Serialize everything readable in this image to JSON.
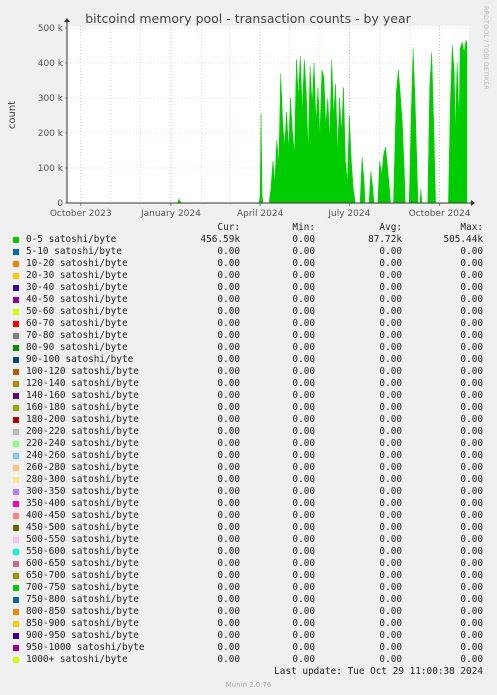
{
  "chart_data": {
    "type": "area",
    "title": "bitcoind memory pool - transaction counts - by year",
    "ylabel": "count",
    "watermark": "RRDTOOL / TOBI OETIKER",
    "ylim": [
      0,
      500000
    ],
    "y_ticks": [
      {
        "value": 0,
        "label": "0"
      },
      {
        "value": 100000,
        "label": "100 k"
      },
      {
        "value": 200000,
        "label": "200 k"
      },
      {
        "value": 300000,
        "label": "300 k"
      },
      {
        "value": 400000,
        "label": "400 k"
      },
      {
        "value": 500000,
        "label": "500 k"
      }
    ],
    "x_ticks": [
      "October 2023",
      "January 2024",
      "April 2024",
      "July 2024",
      "October 2024"
    ],
    "series": [
      {
        "name": "0-5 satoshi/byte",
        "color": "#00cc00",
        "points": [
          [
            "2024-01-08",
            0
          ],
          [
            "2024-01-09",
            12000
          ],
          [
            "2024-01-10",
            6000
          ],
          [
            "2024-01-12",
            0
          ],
          [
            "2024-03-31",
            0
          ],
          [
            "2024-04-01",
            20000
          ],
          [
            "2024-04-02",
            255000
          ],
          [
            "2024-04-03",
            20000
          ],
          [
            "2024-04-04",
            0
          ],
          [
            "2024-04-10",
            0
          ],
          [
            "2024-04-12",
            40000
          ],
          [
            "2024-04-14",
            120000
          ],
          [
            "2024-04-16",
            60000
          ],
          [
            "2024-04-18",
            180000
          ],
          [
            "2024-04-20",
            110000
          ],
          [
            "2024-04-22",
            370000
          ],
          [
            "2024-04-24",
            230000
          ],
          [
            "2024-04-26",
            160000
          ],
          [
            "2024-04-28",
            260000
          ],
          [
            "2024-04-30",
            150000
          ],
          [
            "2024-05-02",
            300000
          ],
          [
            "2024-05-04",
            200000
          ],
          [
            "2024-05-06",
            140000
          ],
          [
            "2024-05-08",
            410000
          ],
          [
            "2024-05-10",
            300000
          ],
          [
            "2024-05-12",
            420000
          ],
          [
            "2024-05-14",
            260000
          ],
          [
            "2024-05-16",
            410000
          ],
          [
            "2024-05-18",
            320000
          ],
          [
            "2024-05-20",
            150000
          ],
          [
            "2024-05-22",
            390000
          ],
          [
            "2024-05-24",
            280000
          ],
          [
            "2024-05-26",
            400000
          ],
          [
            "2024-05-28",
            230000
          ],
          [
            "2024-05-30",
            330000
          ],
          [
            "2024-06-01",
            190000
          ],
          [
            "2024-06-03",
            380000
          ],
          [
            "2024-06-05",
            360000
          ],
          [
            "2024-06-07",
            220000
          ],
          [
            "2024-06-09",
            300000
          ],
          [
            "2024-06-11",
            180000
          ],
          [
            "2024-06-13",
            410000
          ],
          [
            "2024-06-15",
            250000
          ],
          [
            "2024-06-17",
            340000
          ],
          [
            "2024-06-19",
            140000
          ],
          [
            "2024-06-21",
            300000
          ],
          [
            "2024-06-23",
            200000
          ],
          [
            "2024-06-25",
            330000
          ],
          [
            "2024-06-27",
            120000
          ],
          [
            "2024-06-29",
            60000
          ],
          [
            "2024-07-01",
            250000
          ],
          [
            "2024-07-03",
            120000
          ],
          [
            "2024-07-05",
            40000
          ],
          [
            "2024-07-07",
            0
          ],
          [
            "2024-07-12",
            0
          ],
          [
            "2024-07-14",
            130000
          ],
          [
            "2024-07-16",
            60000
          ],
          [
            "2024-07-17",
            0
          ],
          [
            "2024-07-21",
            0
          ],
          [
            "2024-07-23",
            90000
          ],
          [
            "2024-07-25",
            40000
          ],
          [
            "2024-07-26",
            0
          ],
          [
            "2024-07-30",
            0
          ],
          [
            "2024-08-01",
            120000
          ],
          [
            "2024-08-03",
            80000
          ],
          [
            "2024-08-05",
            140000
          ],
          [
            "2024-08-07",
            160000
          ],
          [
            "2024-08-09",
            100000
          ],
          [
            "2024-08-11",
            40000
          ],
          [
            "2024-08-12",
            0
          ],
          [
            "2024-08-15",
            0
          ],
          [
            "2024-08-18",
            320000
          ],
          [
            "2024-08-20",
            380000
          ],
          [
            "2024-08-22",
            310000
          ],
          [
            "2024-08-24",
            230000
          ],
          [
            "2024-08-26",
            90000
          ],
          [
            "2024-08-27",
            0
          ],
          [
            "2024-08-31",
            0
          ],
          [
            "2024-09-02",
            240000
          ],
          [
            "2024-09-04",
            440000
          ],
          [
            "2024-09-06",
            300000
          ],
          [
            "2024-09-08",
            100000
          ],
          [
            "2024-09-09",
            0
          ],
          [
            "2024-09-11",
            0
          ],
          [
            "2024-09-12",
            40000
          ],
          [
            "2024-09-13",
            0
          ],
          [
            "2024-09-19",
            0
          ],
          [
            "2024-09-21",
            330000
          ],
          [
            "2024-09-23",
            430000
          ],
          [
            "2024-09-25",
            230000
          ],
          [
            "2024-09-27",
            0
          ],
          [
            "2024-10-10",
            0
          ],
          [
            "2024-10-12",
            280000
          ],
          [
            "2024-10-14",
            450000
          ],
          [
            "2024-10-16",
            370000
          ],
          [
            "2024-10-17",
            200000
          ],
          [
            "2024-10-19",
            400000
          ],
          [
            "2024-10-21",
            230000
          ],
          [
            "2024-10-22",
            440000
          ],
          [
            "2024-10-24",
            460000
          ],
          [
            "2024-10-26",
            430000
          ],
          [
            "2024-10-28",
            465000
          ],
          [
            "2024-10-29",
            456590
          ]
        ]
      }
    ]
  },
  "legend": {
    "headers": {
      "cur": "Cur:",
      "min": "Min:",
      "avg": "Avg:",
      "max": "Max:"
    },
    "rows": [
      {
        "label": "0-5 satoshi/byte",
        "color": "#00cc00",
        "cur": "456.59k",
        "min": "0.00",
        "avg": "87.72k",
        "max": "505.44k"
      },
      {
        "label": "5-10 satoshi/byte",
        "color": "#0066b3",
        "cur": "0.00",
        "min": "0.00",
        "avg": "0.00",
        "max": "0.00"
      },
      {
        "label": "10-20 satoshi/byte",
        "color": "#ff8000",
        "cur": "0.00",
        "min": "0.00",
        "avg": "0.00",
        "max": "0.00"
      },
      {
        "label": "20-30 satoshi/byte",
        "color": "#ffcc00",
        "cur": "0.00",
        "min": "0.00",
        "avg": "0.00",
        "max": "0.00"
      },
      {
        "label": "30-40 satoshi/byte",
        "color": "#330099",
        "cur": "0.00",
        "min": "0.00",
        "avg": "0.00",
        "max": "0.00"
      },
      {
        "label": "40-50 satoshi/byte",
        "color": "#990099",
        "cur": "0.00",
        "min": "0.00",
        "avg": "0.00",
        "max": "0.00"
      },
      {
        "label": "50-60 satoshi/byte",
        "color": "#ccff00",
        "cur": "0.00",
        "min": "0.00",
        "avg": "0.00",
        "max": "0.00"
      },
      {
        "label": "60-70 satoshi/byte",
        "color": "#ff0000",
        "cur": "0.00",
        "min": "0.00",
        "avg": "0.00",
        "max": "0.00"
      },
      {
        "label": "70-80 satoshi/byte",
        "color": "#808080",
        "cur": "0.00",
        "min": "0.00",
        "avg": "0.00",
        "max": "0.00"
      },
      {
        "label": "80-90 satoshi/byte",
        "color": "#008f00",
        "cur": "0.00",
        "min": "0.00",
        "avg": "0.00",
        "max": "0.00"
      },
      {
        "label": "90-100 satoshi/byte",
        "color": "#00487d",
        "cur": "0.00",
        "min": "0.00",
        "avg": "0.00",
        "max": "0.00"
      },
      {
        "label": "100-120 satoshi/byte",
        "color": "#b35a00",
        "cur": "0.00",
        "min": "0.00",
        "avg": "0.00",
        "max": "0.00"
      },
      {
        "label": "120-140 satoshi/byte",
        "color": "#b38f00",
        "cur": "0.00",
        "min": "0.00",
        "avg": "0.00",
        "max": "0.00"
      },
      {
        "label": "140-160 satoshi/byte",
        "color": "#6b006b",
        "cur": "0.00",
        "min": "0.00",
        "avg": "0.00",
        "max": "0.00"
      },
      {
        "label": "160-180 satoshi/byte",
        "color": "#8fb300",
        "cur": "0.00",
        "min": "0.00",
        "avg": "0.00",
        "max": "0.00"
      },
      {
        "label": "180-200 satoshi/byte",
        "color": "#b30000",
        "cur": "0.00",
        "min": "0.00",
        "avg": "0.00",
        "max": "0.00"
      },
      {
        "label": "200-220 satoshi/byte",
        "color": "#bebebe",
        "cur": "0.00",
        "min": "0.00",
        "avg": "0.00",
        "max": "0.00"
      },
      {
        "label": "220-240 satoshi/byte",
        "color": "#80ff80",
        "cur": "0.00",
        "min": "0.00",
        "avg": "0.00",
        "max": "0.00"
      },
      {
        "label": "240-260 satoshi/byte",
        "color": "#80c9ff",
        "cur": "0.00",
        "min": "0.00",
        "avg": "0.00",
        "max": "0.00"
      },
      {
        "label": "260-280 satoshi/byte",
        "color": "#ffc080",
        "cur": "0.00",
        "min": "0.00",
        "avg": "0.00",
        "max": "0.00"
      },
      {
        "label": "280-300 satoshi/byte",
        "color": "#ffe680",
        "cur": "0.00",
        "min": "0.00",
        "avg": "0.00",
        "max": "0.00"
      },
      {
        "label": "300-350 satoshi/byte",
        "color": "#aa80ff",
        "cur": "0.00",
        "min": "0.00",
        "avg": "0.00",
        "max": "0.00"
      },
      {
        "label": "350-400 satoshi/byte",
        "color": "#ee00cc",
        "cur": "0.00",
        "min": "0.00",
        "avg": "0.00",
        "max": "0.00"
      },
      {
        "label": "400-450 satoshi/byte",
        "color": "#ff8080",
        "cur": "0.00",
        "min": "0.00",
        "avg": "0.00",
        "max": "0.00"
      },
      {
        "label": "450-500 satoshi/byte",
        "color": "#666600",
        "cur": "0.00",
        "min": "0.00",
        "avg": "0.00",
        "max": "0.00"
      },
      {
        "label": "500-550 satoshi/byte",
        "color": "#ffbfff",
        "cur": "0.00",
        "min": "0.00",
        "avg": "0.00",
        "max": "0.00"
      },
      {
        "label": "550-600 satoshi/byte",
        "color": "#00ffcc",
        "cur": "0.00",
        "min": "0.00",
        "avg": "0.00",
        "max": "0.00"
      },
      {
        "label": "600-650 satoshi/byte",
        "color": "#cc6699",
        "cur": "0.00",
        "min": "0.00",
        "avg": "0.00",
        "max": "0.00"
      },
      {
        "label": "650-700 satoshi/byte",
        "color": "#999900",
        "cur": "0.00",
        "min": "0.00",
        "avg": "0.00",
        "max": "0.00"
      },
      {
        "label": "700-750 satoshi/byte",
        "color": "#00cc00",
        "cur": "0.00",
        "min": "0.00",
        "avg": "0.00",
        "max": "0.00"
      },
      {
        "label": "750-800 satoshi/byte",
        "color": "#0066b3",
        "cur": "0.00",
        "min": "0.00",
        "avg": "0.00",
        "max": "0.00"
      },
      {
        "label": "800-850 satoshi/byte",
        "color": "#ff8000",
        "cur": "0.00",
        "min": "0.00",
        "avg": "0.00",
        "max": "0.00"
      },
      {
        "label": "850-900 satoshi/byte",
        "color": "#ffcc00",
        "cur": "0.00",
        "min": "0.00",
        "avg": "0.00",
        "max": "0.00"
      },
      {
        "label": "900-950 satoshi/byte",
        "color": "#330099",
        "cur": "0.00",
        "min": "0.00",
        "avg": "0.00",
        "max": "0.00"
      },
      {
        "label": "950-1000 satoshi/byte",
        "color": "#990099",
        "cur": "0.00",
        "min": "0.00",
        "avg": "0.00",
        "max": "0.00"
      },
      {
        "label": "1000+ satoshi/byte",
        "color": "#ccff00",
        "cur": "0.00",
        "min": "0.00",
        "avg": "0.00",
        "max": "0.00"
      }
    ]
  },
  "last_update": "Last update: Tue Oct 29 11:00:38 2024",
  "footer": "Munin 2.0.76"
}
